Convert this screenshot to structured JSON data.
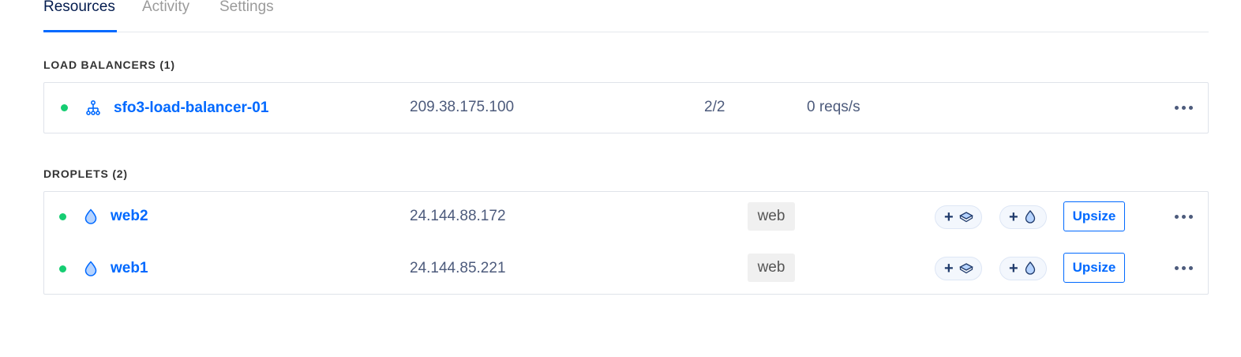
{
  "tabs": [
    {
      "label": "Resources",
      "active": true
    },
    {
      "label": "Activity",
      "active": false
    },
    {
      "label": "Settings",
      "active": false
    }
  ],
  "load_balancers": {
    "heading": "LOAD BALANCERS (1)",
    "items": [
      {
        "status": "active",
        "name": "sfo3-load-balancer-01",
        "ip": "209.38.175.100",
        "nodes": "2/2",
        "rate": "0 reqs/s"
      }
    ]
  },
  "droplets": {
    "heading": "DROPLETS (2)",
    "items": [
      {
        "status": "active",
        "name": "web2",
        "ip": "24.144.88.172",
        "tag": "web",
        "upsize_label": "Upsize"
      },
      {
        "status": "active",
        "name": "web1",
        "ip": "24.144.85.221",
        "tag": "web",
        "upsize_label": "Upsize"
      }
    ]
  },
  "colors": {
    "accent": "#0069ff",
    "status_active": "#15cd72",
    "text": "#4d5b7c"
  },
  "icons": {
    "load_balancer": "load-balancer-icon",
    "droplet": "droplet-icon",
    "add_volume": "plus-volume-icon",
    "add_droplet": "plus-droplet-icon",
    "more": "more-horizontal-icon"
  }
}
